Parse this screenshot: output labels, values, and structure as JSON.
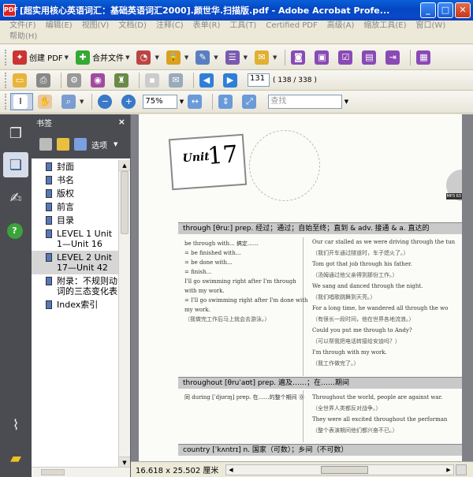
{
  "window": {
    "title": "[超实用核心英语词汇：基础英语词汇2000].颜世华.扫描版.pdf - Adobe Acrobat Profe...",
    "app_icon": "pdf-icon",
    "minimize": "_",
    "maximize": "□",
    "close": "✕"
  },
  "menu": {
    "row1": [
      "文件(F)",
      "编辑(E)",
      "视图(V)",
      "文档(D)",
      "注释(C)",
      "表单(R)",
      "工具(T)",
      "Certified PDF",
      "高级(A)",
      "缩放工具(E)",
      "窗口(W)"
    ],
    "row2": [
      "帮助(H)"
    ]
  },
  "toolbar1": {
    "create_pdf": "创建 PDF",
    "combine_files": "合并文件"
  },
  "toolbar2": {
    "page_number": "131",
    "page_count": "( 138 / 338 )"
  },
  "toolbar3": {
    "zoom": "75%",
    "find_placeholder": "查找"
  },
  "bookmarks": {
    "title": "书签",
    "options": "选项",
    "close": "×",
    "items": [
      {
        "label": "封面",
        "selected": false
      },
      {
        "label": "书名",
        "selected": false
      },
      {
        "label": "版权",
        "selected": false
      },
      {
        "label": "前言",
        "selected": false
      },
      {
        "label": "目录",
        "selected": false
      },
      {
        "label": "LEVEL 1 Unit 1—Unit 16",
        "selected": false
      },
      {
        "label": "LEVEL 2 Unit 17—Unit 42",
        "selected": true
      },
      {
        "label": "附录：不规则动词的三态变化表",
        "selected": false
      },
      {
        "label": "Index索引",
        "selected": false
      }
    ]
  },
  "document": {
    "unit_word": "Unit",
    "unit_number": "17",
    "mp3": "MP3 63",
    "entry1_head": "through [θruː] prep. 经过；通过；自始至终；直到 & adv. 接通 & a. 直达的",
    "entry1_left": [
      "be through with...    搞定……",
      "= be finished with...",
      "= be done with...",
      "= finish...",
      "I'll go swimming right after I'm through",
      "  with my work.",
      "= I'll go swimming right after I'm done with",
      "  my work.",
      "（我做完工作后马上就会去游泳。）"
    ],
    "entry1_right": [
      "Our car stalled as we were driving through the tun",
      "（我们开车通过隧道时，车子熄火了。）",
      "Tom got that job through his father.",
      "（汤姆通过他父亲得到那份工作。）",
      "We sang and danced through the night.",
      "（我们唱歌跳舞到天亮。）",
      "For a long time, he wandered all through the wo",
      "（有很长一段时间，他在世界各地流浪。）",
      "Could you put me through to Andy?",
      "（可以帮我把电话转接给安迪吗？）",
      "I'm through with my work.",
      "（我工作做完了。）"
    ],
    "entry2_head": "throughout [θruˈaʊt] prep. 遍及……；在……期间",
    "entry2_left": [
      "同 during [ˈdjʊrɪŋ] prep. 在……的整个期间 ⓪"
    ],
    "entry2_right": [
      "Throughout the world, people are against war.",
      "（全世界人类都反对战争。）",
      "They were all excited throughout the performan",
      "（整个表演期间他们都兴奋不已。）"
    ],
    "entry3_head": "country [ˈkʌntrɪ] n. 国家（可数）；乡间（不可数）"
  },
  "status": {
    "page_size": "16.618 x 25.502 厘米"
  }
}
